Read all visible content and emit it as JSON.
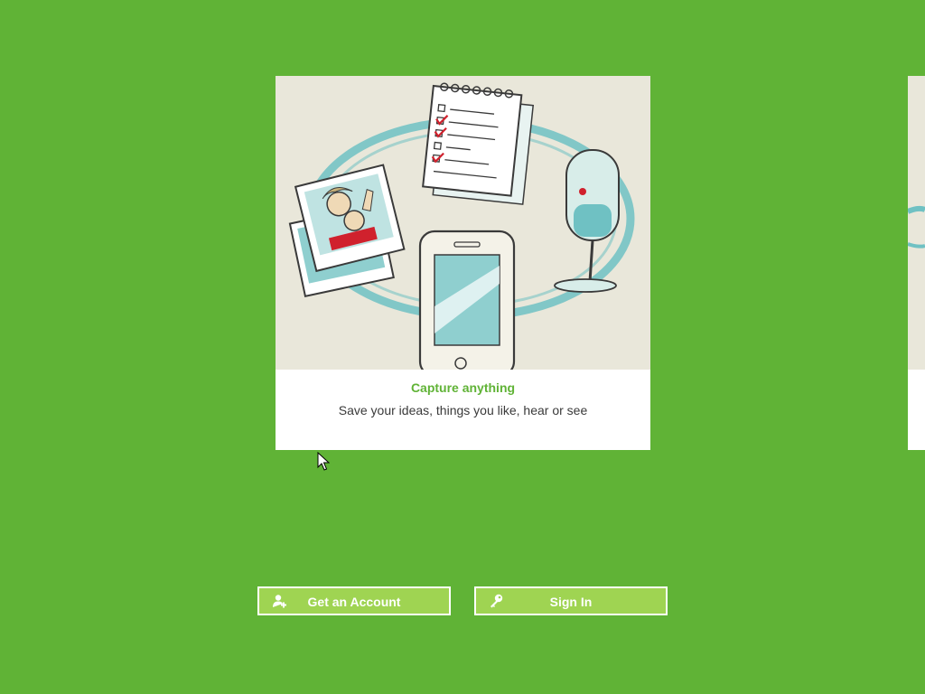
{
  "card": {
    "title": "Capture anything",
    "subtitle": "Save your ideas, things you like, hear or see"
  },
  "buttons": {
    "get_account": {
      "label": "Get an Account",
      "icon": "add-user-icon"
    },
    "sign_in": {
      "label": "Sign In",
      "icon": "key-icon"
    }
  },
  "colors": {
    "background": "#60b336",
    "title": "#60b336",
    "button_fill": "#9fd452",
    "button_border": "#ffffff",
    "illustration_bg": "#e9e7da",
    "accent_teal": "#6fc1c3",
    "accent_red": "#d0212d"
  }
}
